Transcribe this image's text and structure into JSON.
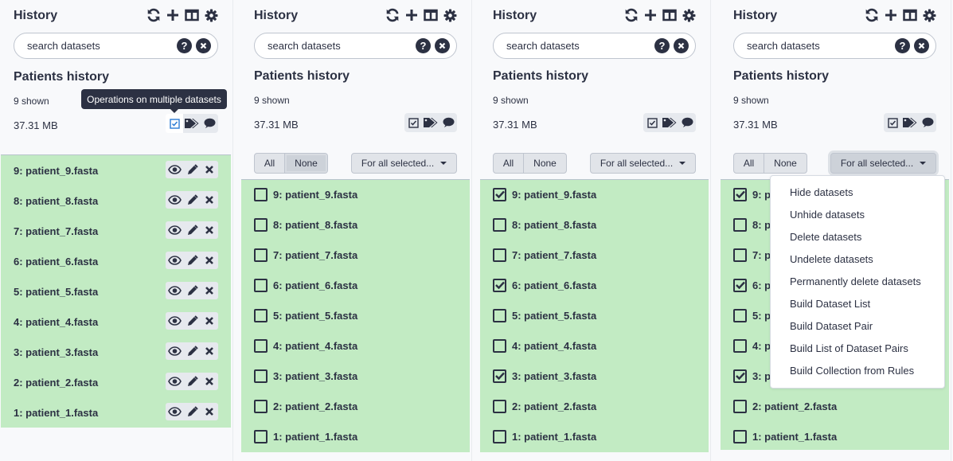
{
  "colors": {
    "text": "#2c3143",
    "dataset_ok_bg": "#c2ebc3",
    "panel_bg": "#f8f9fb",
    "tooltip_bg": "#2c3143"
  },
  "panels": [
    {
      "header": {
        "title": "History",
        "icons": [
          "refresh-icon",
          "plus-icon",
          "columns-icon",
          "gear-icon"
        ]
      },
      "search": {
        "placeholder": "search datasets"
      },
      "history_name": "Patients history",
      "shown": "9 shown",
      "size": "37.31 MB",
      "tooltip": "Operations on multiple datasets",
      "datasets": [
        "9: patient_9.fasta",
        "8: patient_8.fasta",
        "7: patient_7.fasta",
        "6: patient_6.fasta",
        "5: patient_5.fasta",
        "4: patient_4.fasta",
        "3: patient_3.fasta",
        "2: patient_2.fasta",
        "1: patient_1.fasta"
      ]
    },
    {
      "header": {
        "title": "History"
      },
      "search": {
        "placeholder": "search datasets"
      },
      "history_name": "Patients history",
      "shown": "9 shown",
      "size": "37.31 MB",
      "select_all": "All",
      "select_none": "None",
      "for_all_selected": "For all selected...",
      "datasets": [
        {
          "label": "9: patient_9.fasta",
          "checked": false
        },
        {
          "label": "8: patient_8.fasta",
          "checked": false
        },
        {
          "label": "7: patient_7.fasta",
          "checked": false
        },
        {
          "label": "6: patient_6.fasta",
          "checked": false
        },
        {
          "label": "5: patient_5.fasta",
          "checked": false
        },
        {
          "label": "4: patient_4.fasta",
          "checked": false
        },
        {
          "label": "3: patient_3.fasta",
          "checked": false
        },
        {
          "label": "2: patient_2.fasta",
          "checked": false
        },
        {
          "label": "1: patient_1.fasta",
          "checked": false
        }
      ]
    },
    {
      "header": {
        "title": "History"
      },
      "search": {
        "placeholder": "search datasets"
      },
      "history_name": "Patients history",
      "shown": "9 shown",
      "size": "37.31 MB",
      "select_all": "All",
      "select_none": "None",
      "for_all_selected": "For all selected...",
      "datasets": [
        {
          "label": "9: patient_9.fasta",
          "checked": true
        },
        {
          "label": "8: patient_8.fasta",
          "checked": false
        },
        {
          "label": "7: patient_7.fasta",
          "checked": false
        },
        {
          "label": "6: patient_6.fasta",
          "checked": true
        },
        {
          "label": "5: patient_5.fasta",
          "checked": false
        },
        {
          "label": "4: patient_4.fasta",
          "checked": false
        },
        {
          "label": "3: patient_3.fasta",
          "checked": true
        },
        {
          "label": "2: patient_2.fasta",
          "checked": false
        },
        {
          "label": "1: patient_1.fasta",
          "checked": false
        }
      ]
    },
    {
      "header": {
        "title": "History"
      },
      "search": {
        "placeholder": "search datasets"
      },
      "history_name": "Patients history",
      "shown": "9 shown",
      "size": "37.31 MB",
      "select_all": "All",
      "select_none": "None",
      "for_all_selected": "For all selected...",
      "datasets": [
        {
          "label": "9: p",
          "checked": true
        },
        {
          "label": "8: p",
          "checked": false
        },
        {
          "label": "7: p",
          "checked": false
        },
        {
          "label": "6: p",
          "checked": true
        },
        {
          "label": "5: p",
          "checked": false
        },
        {
          "label": "4: p",
          "checked": false
        },
        {
          "label": "3: p",
          "checked": true
        },
        {
          "label": "2: patient_2.fasta",
          "checked": false
        },
        {
          "label": "1: patient_1.fasta",
          "checked": false
        }
      ],
      "dropdown": [
        "Hide datasets",
        "Unhide datasets",
        "Delete datasets",
        "Undelete datasets",
        "Permanently delete datasets",
        "Build Dataset List",
        "Build Dataset Pair",
        "Build List of Dataset Pairs",
        "Build Collection from Rules"
      ]
    }
  ]
}
